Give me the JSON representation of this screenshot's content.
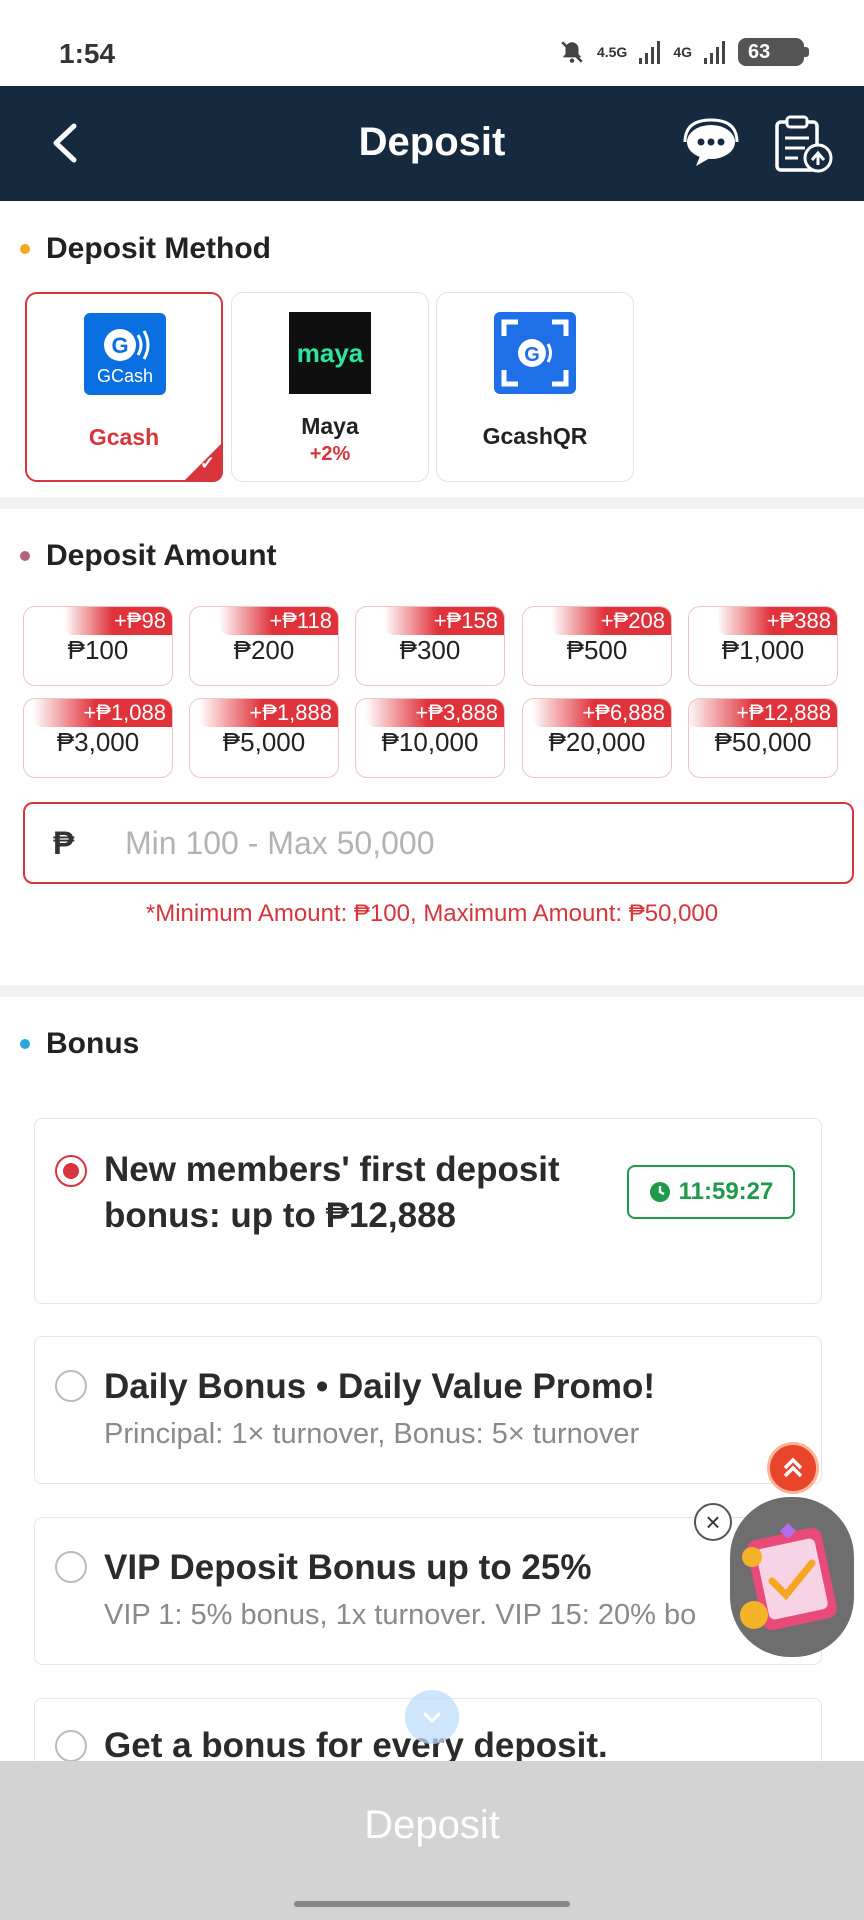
{
  "status_bar": {
    "time": "1:54",
    "network_1": "4.5G",
    "network_2": "4G",
    "battery": "63"
  },
  "header": {
    "title": "Deposit",
    "back_icon": "chevron-left-icon",
    "support_icon": "chat-support-icon",
    "history_icon": "clipboard-history-icon"
  },
  "deposit_method": {
    "title": "Deposit Method",
    "methods": [
      {
        "name": "Gcash",
        "logo_text": "GCash",
        "bonus": "",
        "selected": true
      },
      {
        "name": "Maya",
        "logo_text": "maya",
        "bonus": "+2%",
        "selected": false
      },
      {
        "name": "GcashQR",
        "logo_text": "",
        "bonus": "",
        "selected": false
      }
    ]
  },
  "deposit_amount": {
    "title": "Deposit Amount",
    "chips": [
      {
        "amount": "₱100",
        "bonus": "+₱98"
      },
      {
        "amount": "₱200",
        "bonus": "+₱118"
      },
      {
        "amount": "₱300",
        "bonus": "+₱158"
      },
      {
        "amount": "₱500",
        "bonus": "+₱208"
      },
      {
        "amount": "₱1,000",
        "bonus": "+₱388"
      },
      {
        "amount": "₱3,000",
        "bonus": "+₱1,088"
      },
      {
        "amount": "₱5,000",
        "bonus": "+₱1,888"
      },
      {
        "amount": "₱10,000",
        "bonus": "+₱3,888"
      },
      {
        "amount": "₱20,000",
        "bonus": "+₱6,888"
      },
      {
        "amount": "₱50,000",
        "bonus": "+₱12,888"
      }
    ],
    "currency_symbol": "₱",
    "input_value": "",
    "input_placeholder": "Min 100 - Max 50,000",
    "note": "*Minimum Amount: ₱100, Maximum Amount: ₱50,000"
  },
  "bonus": {
    "title": "Bonus",
    "options": [
      {
        "title_line1": "New members' first deposit",
        "title_line2": "bonus: up to ₱12,888",
        "subtitle": "",
        "timer": "11:59:27",
        "selected": true
      },
      {
        "title": "Daily Bonus • Daily Value Promo!",
        "subtitle": "Principal: 1× turnover, Bonus: 5× turnover",
        "selected": false
      },
      {
        "title": "VIP Deposit Bonus up to 25%",
        "subtitle": "VIP 1: 5% bonus, 1x turnover. VIP 15: 20% bo",
        "selected": false
      },
      {
        "title": "Get a bonus for every deposit.",
        "subtitle": "",
        "selected": false
      }
    ]
  },
  "footer": {
    "deposit_button": "Deposit"
  },
  "colors": {
    "header_bg": "#152a3f",
    "accent_red": "#d8343b",
    "timer_green": "#1f9a4b",
    "dot_method": "#f5a623",
    "dot_amount": "#b5637a",
    "dot_bonus": "#29a8e0"
  }
}
